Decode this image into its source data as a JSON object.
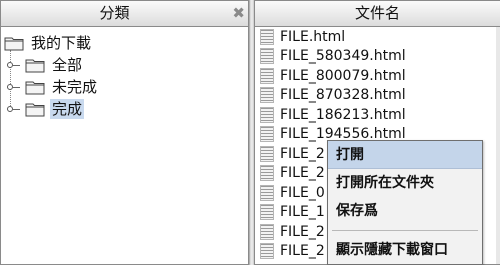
{
  "left_pane": {
    "header": "分類",
    "close_icon": "✖",
    "tree": {
      "root_label": "我的下載",
      "children": [
        {
          "label": "全部"
        },
        {
          "label": "未完成"
        },
        {
          "label": "完成",
          "selected": true
        }
      ]
    }
  },
  "right_pane": {
    "header": "文件名",
    "files": [
      "FILE.html",
      "FILE_580349.html",
      "FILE_800079.html",
      "FILE_870328.html",
      "FILE_186213.html",
      "FILE_194556.html",
      "FILE_2",
      "FILE_2",
      "FILE_0",
      "FILE_1",
      "FILE_2",
      "FILE_2"
    ]
  },
  "context_menu": {
    "items": [
      "打開",
      "打開所在文件夾",
      "保存爲",
      "顯示隱藏下載窗口"
    ],
    "highlighted_index": 0
  },
  "colors": {
    "selection": "#c8d9ee",
    "menu_highlight": "#c4d5ea",
    "border": "#8a8a8a"
  }
}
